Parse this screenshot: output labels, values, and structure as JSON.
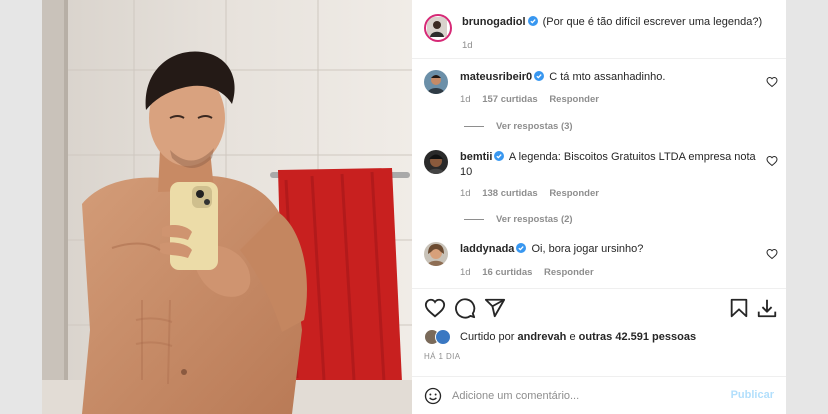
{
  "post": {
    "author": "brunogadiol",
    "caption": "(Por que é tão difícil escrever uma legenda?)",
    "time": "1d"
  },
  "comments": [
    {
      "user": "mateusribeir0",
      "text": "C tá mto assanhadinho.",
      "time": "1d",
      "likes": "157 curtidas",
      "reply": "Responder",
      "view_replies": "Ver respostas (3)"
    },
    {
      "user": "bemtii",
      "text": "A legenda: Biscoitos Gratuitos LTDA empresa nota 10",
      "time": "1d",
      "likes": "138 curtidas",
      "reply": "Responder",
      "view_replies": "Ver respostas (2)"
    },
    {
      "user": "laddynada",
      "text": "Oi, bora jogar ursinho?",
      "time": "1d",
      "likes": "16 curtidas",
      "reply": "Responder"
    }
  ],
  "likes_line": {
    "prefix": "Curtido por",
    "user": "andrevah",
    "middle": "e",
    "others": "outras 42.591 pessoas"
  },
  "date": "HÁ 1 DIA",
  "comment_input": {
    "placeholder": "Adicione um comentário...",
    "publish": "Publicar"
  },
  "icons": {
    "like": "heart-icon",
    "comment": "comment-icon",
    "share": "send-icon",
    "save": "bookmark-icon",
    "download": "download-icon",
    "emoji": "emoji-icon",
    "verified": "verified-badge-icon"
  },
  "colors": {
    "verified": "#3897f0",
    "muted": "#8e8e8e",
    "publish_disabled": "#b2dffc",
    "towel": "#c8201f"
  }
}
